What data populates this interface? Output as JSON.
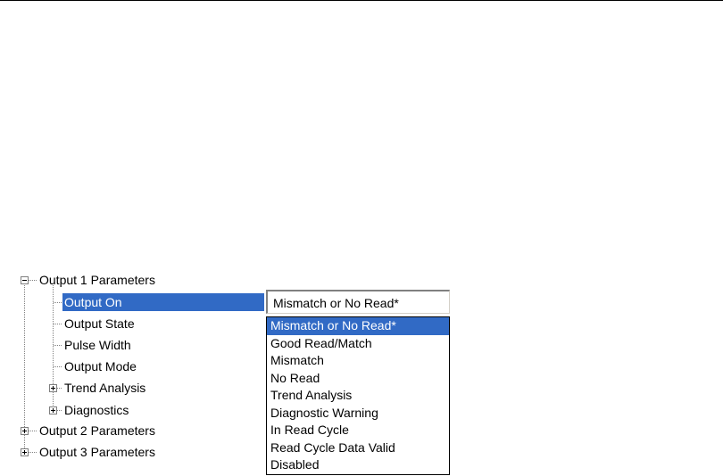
{
  "tree": {
    "items": [
      {
        "label": "Output 1 Parameters",
        "expander": "minus"
      },
      {
        "label": "Output On",
        "selected": true
      },
      {
        "label": "Output State"
      },
      {
        "label": "Pulse Width"
      },
      {
        "label": "Output Mode"
      },
      {
        "label": "Trend Analysis",
        "expander": "plus"
      },
      {
        "label": "Diagnostics",
        "expander": "plus"
      },
      {
        "label": "Output 2 Parameters",
        "expander": "plus"
      },
      {
        "label": "Output 3 Parameters",
        "expander": "plus"
      }
    ]
  },
  "combo": {
    "value": "Mismatch or No Read*"
  },
  "dropdown": {
    "options": [
      "Mismatch or No Read*",
      "Good Read/Match",
      "Mismatch",
      "No Read",
      "Trend Analysis",
      "Diagnostic Warning",
      "In Read Cycle",
      "Read Cycle Data Valid",
      "Disabled"
    ],
    "selected_index": 0
  },
  "colors": {
    "selection": "#316ac5",
    "tree_lines": "#808080"
  }
}
